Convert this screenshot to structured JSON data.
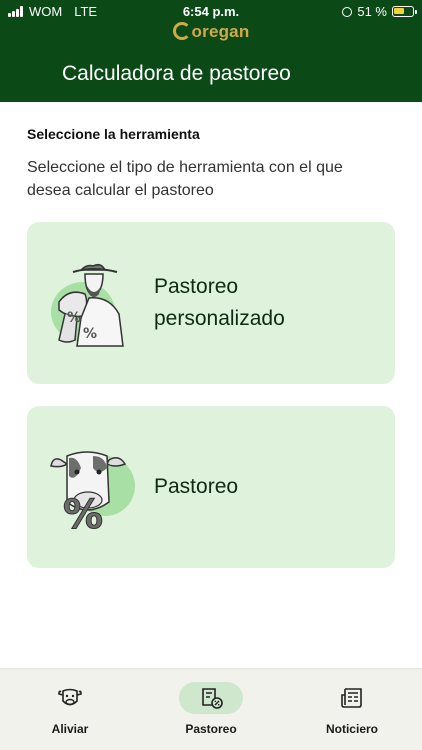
{
  "status_bar": {
    "carrier": "WOM",
    "network": "LTE",
    "time": "6:54 p.m.",
    "battery": "51 %"
  },
  "header": {
    "logo": "oregan",
    "title": "Calculadora de pastoreo"
  },
  "main": {
    "section_label": "Seleccione la herramienta",
    "section_description": "Seleccione el tipo de herramienta con el que desea calcular el pastoreo",
    "cards": [
      {
        "label": "Pastoreo personalizado",
        "icon": "farmer-with-calf-icon"
      },
      {
        "label": "Pastoreo",
        "icon": "cow-percent-icon"
      }
    ]
  },
  "bottom_nav": {
    "items": [
      {
        "label": "Aliviar",
        "icon": "cow-face-icon",
        "active": false
      },
      {
        "label": "Pastoreo",
        "icon": "calculator-tag-icon",
        "active": true
      },
      {
        "label": "Noticiero",
        "icon": "newspaper-icon",
        "active": false
      }
    ]
  },
  "colors": {
    "header_bg": "#0b4a17",
    "logo": "#d2a84a",
    "card_bg": "#dff3dc",
    "active_pill": "#cfe7cc",
    "nav_bg": "#f1f2ec"
  }
}
